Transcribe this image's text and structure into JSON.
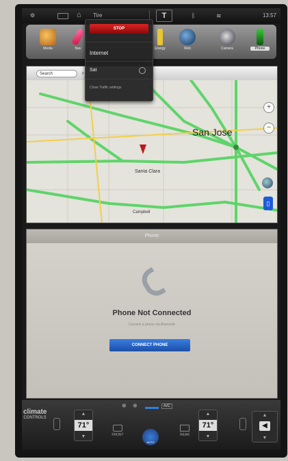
{
  "status": {
    "tire_label": "Tire",
    "tesla_label": "T",
    "time": "13:57"
  },
  "apps": [
    {
      "name": "Media",
      "icon": "music-icon"
    },
    {
      "name": "Nav",
      "icon": "navigation-icon"
    },
    {
      "name": "Energy",
      "icon": "energy-icon"
    },
    {
      "name": "Web",
      "icon": "globe-icon"
    },
    {
      "name": "Camera",
      "icon": "camera-icon"
    },
    {
      "name": "Phone",
      "icon": "phone-icon"
    }
  ],
  "dropdown": {
    "stop_label": "STOP",
    "item1": "Internet",
    "item2": "Sat",
    "item3": "Close Traffic settings"
  },
  "map": {
    "search_placeholder": "Search",
    "city": "San Jose",
    "place1": "Santa Clara",
    "place2": "Campbell"
  },
  "phone": {
    "header": "Phone",
    "title": "Phone Not Connected",
    "subtitle": "Connect a phone via Bluetooth",
    "connect_label": "CONNECT PHONE"
  },
  "climate": {
    "left_label_big": "climate",
    "left_label_small": "CONTROLS",
    "driver_temp": "71°",
    "passenger_temp": "71°",
    "ac_label": "A/C",
    "front_defrost_label": "FRONT",
    "rear_defrost_label": "REAR",
    "center_label": "AUTO"
  },
  "colors": {
    "accent_blue": "#1e5bd8",
    "stop_red": "#c21a1a",
    "traffic_green": "#5fd46a"
  }
}
